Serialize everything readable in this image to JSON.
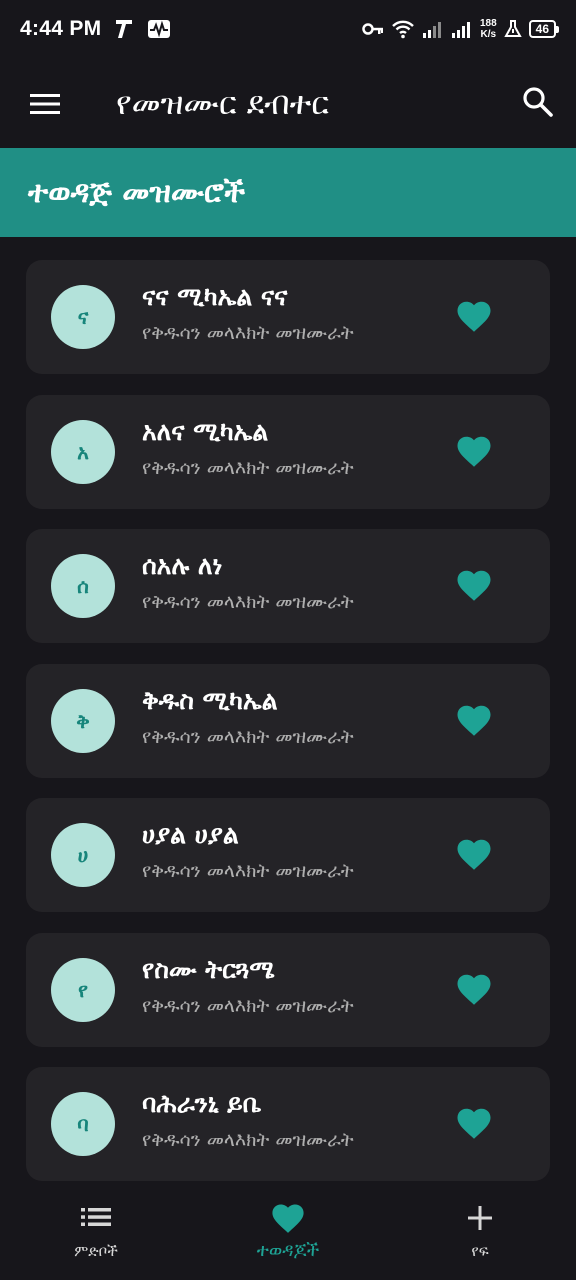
{
  "status_bar": {
    "time": "4:44 PM",
    "net_speed_value": "188",
    "net_speed_unit": "K/s",
    "battery": "46"
  },
  "app_bar": {
    "title": "የመዝሙር ደብተር",
    "menu_icon": "hamburger-menu-icon",
    "search_icon": "search-icon"
  },
  "banner": {
    "title": "ተወዳጅ መዝሙሮች"
  },
  "songs": [
    {
      "initial": "ና",
      "title": "ናና ሚካኤል ናና",
      "subtitle": "የቅዱሳን መላእክት መዝሙራት",
      "favorite": true
    },
    {
      "initial": "አ",
      "title": "አለና ሚካኤል",
      "subtitle": "የቅዱሳን መላእክት መዝሙራት",
      "favorite": true
    },
    {
      "initial": "ሰ",
      "title": "ሰአሉ ለነ",
      "subtitle": "የቅዱሳን መላእክት መዝሙራት",
      "favorite": true
    },
    {
      "initial": "ቅ",
      "title": "ቅዱስ ሚካኤል",
      "subtitle": "የቅዱሳን መላእክት መዝሙራት",
      "favorite": true
    },
    {
      "initial": "ሀ",
      "title": "ሀያል ሀያል",
      "subtitle": "የቅዱሳን መላእክት መዝሙራት",
      "favorite": true
    },
    {
      "initial": "የ",
      "title": "የስሙ ትርጓሜ",
      "subtitle": "የቅዱሳን መላእክት መዝሙራት",
      "favorite": true
    },
    {
      "initial": "ባ",
      "title": "ባሕራንኒ ይቤ",
      "subtitle": "የቅዱሳን መላእክት መዝሙራት",
      "favorite": true
    }
  ],
  "bottom_nav": [
    {
      "label": "ምድቦች",
      "icon": "list-icon",
      "active": false
    },
    {
      "label": "ተወዳጆች",
      "icon": "heart-icon",
      "active": true
    },
    {
      "label": "የፍ",
      "icon": "plus-icon",
      "active": false
    }
  ],
  "colors": {
    "background": "#17161b",
    "card": "#242327",
    "accent": "#208f85",
    "heart": "#1ea395",
    "avatar_bg": "#b3e2da"
  }
}
